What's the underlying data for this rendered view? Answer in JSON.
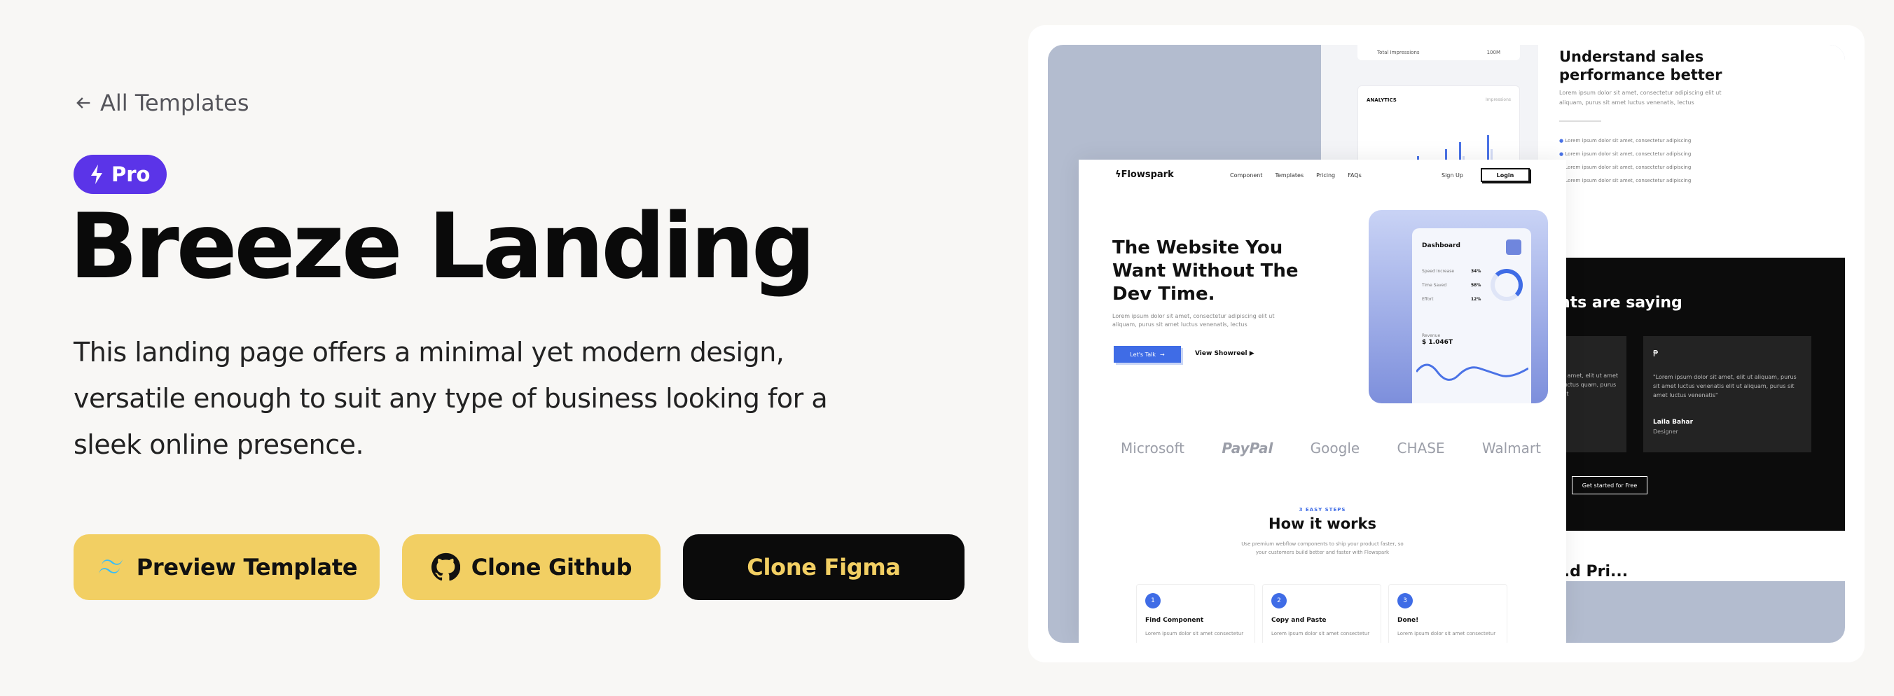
{
  "back_link": {
    "label": "All Templates"
  },
  "badge": {
    "label": "Pro"
  },
  "title": "Breeze Landing",
  "description": "This landing page offers a minimal yet modern design, versatile enough to suit any type of business looking for a sleek online presence.",
  "buttons": {
    "preview": "Preview Template",
    "github": "Clone Github",
    "figma": "Clone Figma"
  },
  "colors": {
    "accent": "#f2cf63",
    "badge": "#5b34e8",
    "dark": "#0b0b0b",
    "background": "#f8f7f5"
  },
  "preview": {
    "back_page": {
      "impressions_label": "Total Impressions",
      "impressions_value": "100M",
      "analytics_label": "ANALYTICS",
      "analytics_sub": "Impressions",
      "heading": "Understand sales performance better",
      "sub": "Lorem ipsum dolor sit amet, consectetur adipiscing elit ut aliquam, purus sit amet luctus venenatis, lectus",
      "list": [
        "Lorem ipsum dolor sit amet, consectetur adipiscing",
        "Lorem ipsum dolor sit amet, consectetur adipiscing",
        "Lorem ipsum dolor sit amet, consectetur adipiscing",
        "Lorem ipsum dolor sit amet, consectetur adipiscing"
      ],
      "testimonials_title": "nts are saying",
      "testimonial_left": "d amet, elit ut amet luctus quam, purus sit",
      "testimonial_quote": "\"Lorem ipsum dolor sit amet, elit ut aliquam, purus sit amet luctus venenatis elit ut aliquam, purus sit amet luctus venenatis\"",
      "testimonial_name": "Laila Bahar",
      "testimonial_role": "Designer",
      "cta": "Get started for Free",
      "partial": "...d Pri..."
    },
    "front_page": {
      "logo": "Flowspark",
      "nav": [
        "Component",
        "Templates",
        "Pricing",
        "FAQs"
      ],
      "signup": "Sign Up",
      "login": "Login",
      "hero_title": "The Website You Want Without The Dev Time.",
      "hero_sub": "Lorem ipsum dolor sit amet, consectetur adipiscing elit ut aliquam, purus sit amet luctus venenatis, lectus",
      "hero_btn": "Let's Talk",
      "hero_link": "View Showreel",
      "dashboard": {
        "title": "Dashboard",
        "rows": [
          {
            "label": "Speed Increase",
            "value": "34%"
          },
          {
            "label": "Time Saved",
            "value": "58%"
          },
          {
            "label": "Effort",
            "value": "12%"
          }
        ],
        "revenue_label": "Revenue",
        "revenue_value": "$ 1.046T"
      },
      "logos": [
        "Microsoft",
        "PayPal",
        "Google",
        "CHASE",
        "Walmart"
      ],
      "steps_kicker": "3 EASY STEPS",
      "steps_title": "How it works",
      "steps_sub": "Use premium webflow components to ship your product faster, so your customers build better and faster with Flowspark",
      "steps": [
        {
          "num": "1",
          "title": "Find Component",
          "sub": "Lorem ipsum dolor sit amet consectetur"
        },
        {
          "num": "2",
          "title": "Copy and Paste",
          "sub": "Lorem ipsum dolor sit amet consectetur"
        },
        {
          "num": "3",
          "title": "Done!",
          "sub": "Lorem ipsum dolor sit amet consectetur"
        }
      ]
    }
  }
}
